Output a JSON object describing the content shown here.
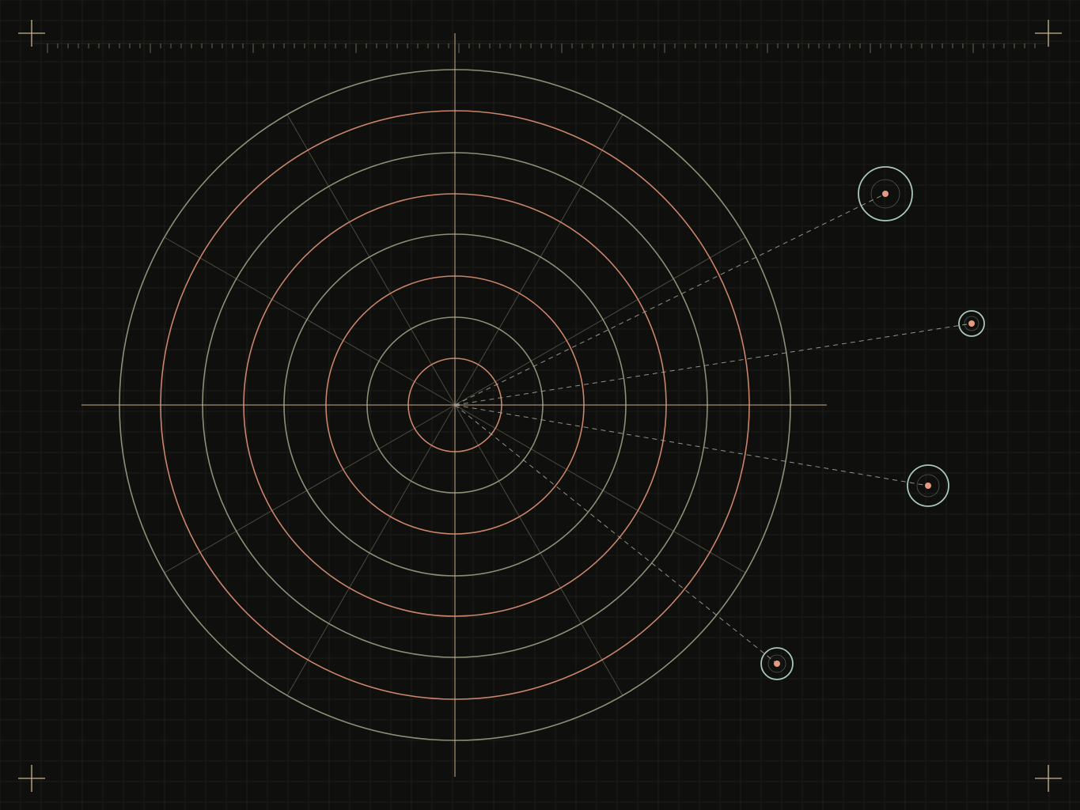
{
  "canvas": {
    "background": "#0f0f0d",
    "grid_color": "#1d1e1a"
  },
  "palette": {
    "ring_olive": "#8c8f76",
    "ring_salmon": "#c9846a",
    "crosshair": "#c9a98c",
    "spoke": "#4a4b42",
    "node_ring": "#a9c6b8",
    "node_core": "#e39a80",
    "leader": "#a9aa9c",
    "corner_mark": "#c9b48f",
    "ruler": "#6e6a55"
  },
  "target": {
    "ring_count": 8,
    "ring_color_sequence": [
      "salmon",
      "olive",
      "salmon",
      "olive",
      "salmon",
      "olive",
      "salmon",
      "olive"
    ],
    "spoke_count": 12
  },
  "nodes": [
    {
      "id": "node-1",
      "size": "large"
    },
    {
      "id": "node-2",
      "size": "small"
    },
    {
      "id": "node-3",
      "size": "medium"
    },
    {
      "id": "node-4",
      "size": "small"
    }
  ],
  "icons": {
    "corners": [
      "corner-crosshair-icon",
      "corner-crosshair-icon",
      "corner-crosshair-icon",
      "corner-crosshair-icon"
    ]
  }
}
